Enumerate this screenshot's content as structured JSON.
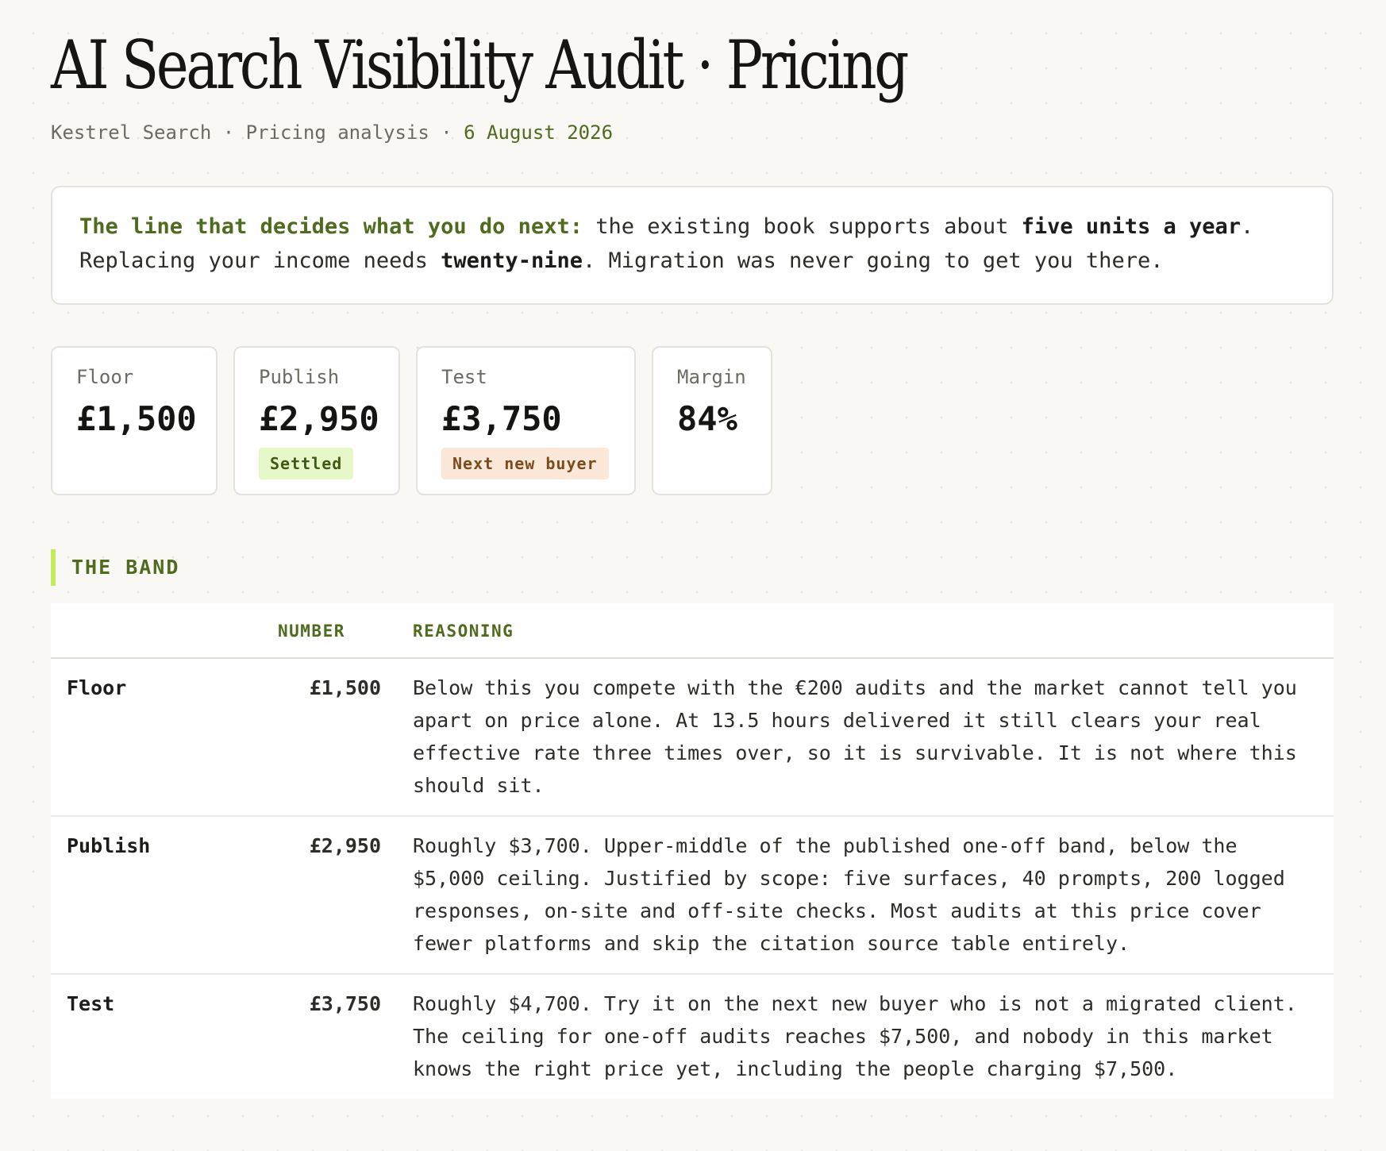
{
  "header": {
    "title": "AI Search Visibility Audit · Pricing",
    "meta_company": "Kestrel Search · Pricing analysis · ",
    "meta_date": "6 August 2026"
  },
  "callout": {
    "lead": "The line that decides what you do next:",
    "text_1": " the existing book supports about ",
    "bold_1": "five units a year",
    "text_2": ". Replacing your income needs ",
    "bold_2": "twenty-nine",
    "text_3": ". Migration was never going to get you there."
  },
  "stats": [
    {
      "label": "Floor",
      "value": "£1,500"
    },
    {
      "label": "Publish",
      "value": "£2,950",
      "badge": "Settled"
    },
    {
      "label": "Test",
      "value": "£3,750",
      "badge": "Next new buyer"
    },
    {
      "label": "Margin",
      "value": "84%"
    }
  ],
  "section": {
    "title": "THE BAND"
  },
  "table": {
    "headers": [
      "",
      "NUMBER",
      "REASONING"
    ],
    "rows": [
      {
        "name": "Floor",
        "number": "£1,500",
        "reasoning": "Below this you compete with the €200 audits and the market cannot tell you apart on price alone. At 13.5 hours delivered it still clears your real effective rate three times over, so it is survivable. It is not where this should sit."
      },
      {
        "name": "Publish",
        "number": "£2,950",
        "reasoning": "Roughly $3,700. Upper-middle of the published one-off band, below the $5,000 ceiling. Justified by scope: five surfaces, 40 prompts, 200 logged responses, on-site and off-site checks. Most audits at this price cover fewer platforms and skip the citation source table entirely."
      },
      {
        "name": "Test",
        "number": "£3,750",
        "reasoning": "Roughly $4,700. Try it on the next new buyer who is not a migrated client. The ceiling for one-off audits reaches $7,500, and nobody in this market knows the right price yet, including the people charging $7,500."
      }
    ]
  },
  "colors": {
    "accent_green": "#4f6b1e",
    "highlight_lime": "#c4ec59",
    "badge_green_bg": "#e6f7c8",
    "badge_orange_bg": "#fbe8d8",
    "background": "#f9f8f4"
  }
}
